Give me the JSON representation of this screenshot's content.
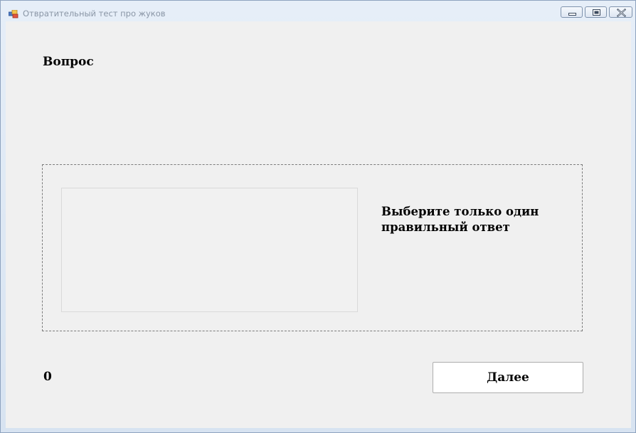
{
  "window": {
    "title": "Отвратительный тест про жуков",
    "icon": "app-window-icon",
    "controls": {
      "minimize_icon": "minimize-icon",
      "maximize_icon": "maximize-icon",
      "close_icon": "close-icon"
    }
  },
  "main": {
    "question_label": "Вопрос",
    "instruction": "Выберите только один правильный ответ",
    "score": "0",
    "next_button_label": "Далее"
  },
  "colors": {
    "client_background": "#f0f0f0",
    "title_text": "#8a96a6",
    "button_background": "#ffffff"
  }
}
